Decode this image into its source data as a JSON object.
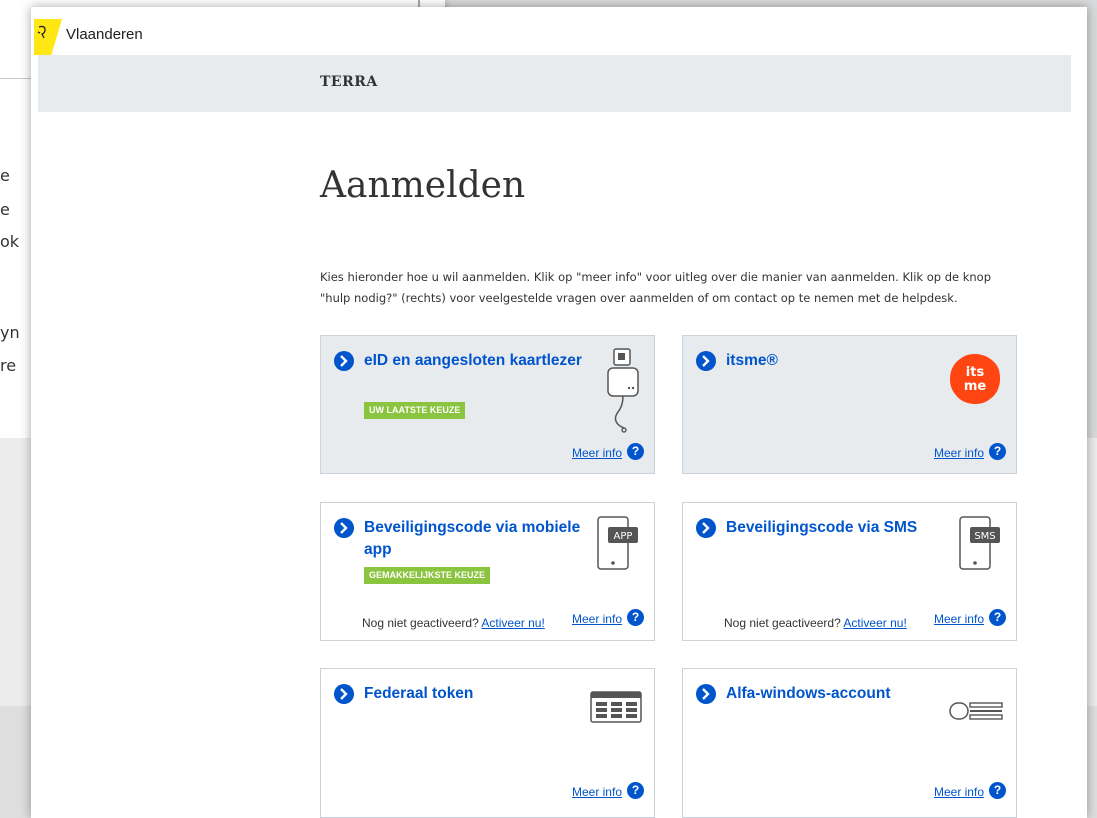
{
  "background": {
    "fragments": [
      "e",
      "e",
      "ok",
      "",
      "yn",
      "re"
    ]
  },
  "header": {
    "brand": "Vlaanderen",
    "app_title": "TERRA"
  },
  "main": {
    "title": "Aanmelden",
    "intro": "Kies hieronder hoe u wil aanmelden. Klik op \"meer info\" voor uitleg over die manier van aanmelden. Klik op de knop \"hulp nodig?\" (rechts) voor veelgestelde vragen over aanmelden of om contact op te nemen met de helpdesk."
  },
  "options": [
    {
      "title": "eID en aangesloten kaartlezer",
      "badge": "UW LAATSTE KEUZE",
      "more": "Meer info",
      "icon": "card-reader-icon",
      "selected": true
    },
    {
      "title": "itsme®",
      "more": "Meer info",
      "icon": "itsme-logo",
      "logo_text": "its me"
    },
    {
      "title": "Beveiligingscode via mobiele app",
      "badge": "GEMAKKELIJKSTE KEUZE",
      "note": "Nog niet geactiveerd?",
      "activate": "Activeer nu!",
      "more": "Meer info",
      "icon": "phone-app-icon",
      "icon_text": "APP"
    },
    {
      "title": "Beveiligingscode via SMS",
      "note": "Nog niet geactiveerd?",
      "activate": "Activeer nu!",
      "more": "Meer info",
      "icon": "phone-sms-icon",
      "icon_text": "SMS"
    },
    {
      "title": "Federaal token",
      "more": "Meer info",
      "icon": "token-grid-icon"
    },
    {
      "title": "Alfa-windows-account",
      "more": "Meer info",
      "icon": "account-icon"
    }
  ],
  "colors": {
    "link": "#0055cc",
    "badge": "#8bc43f",
    "band": "#e8ebee",
    "itsme": "#ff4612",
    "brand_yellow": "#ffe615"
  }
}
